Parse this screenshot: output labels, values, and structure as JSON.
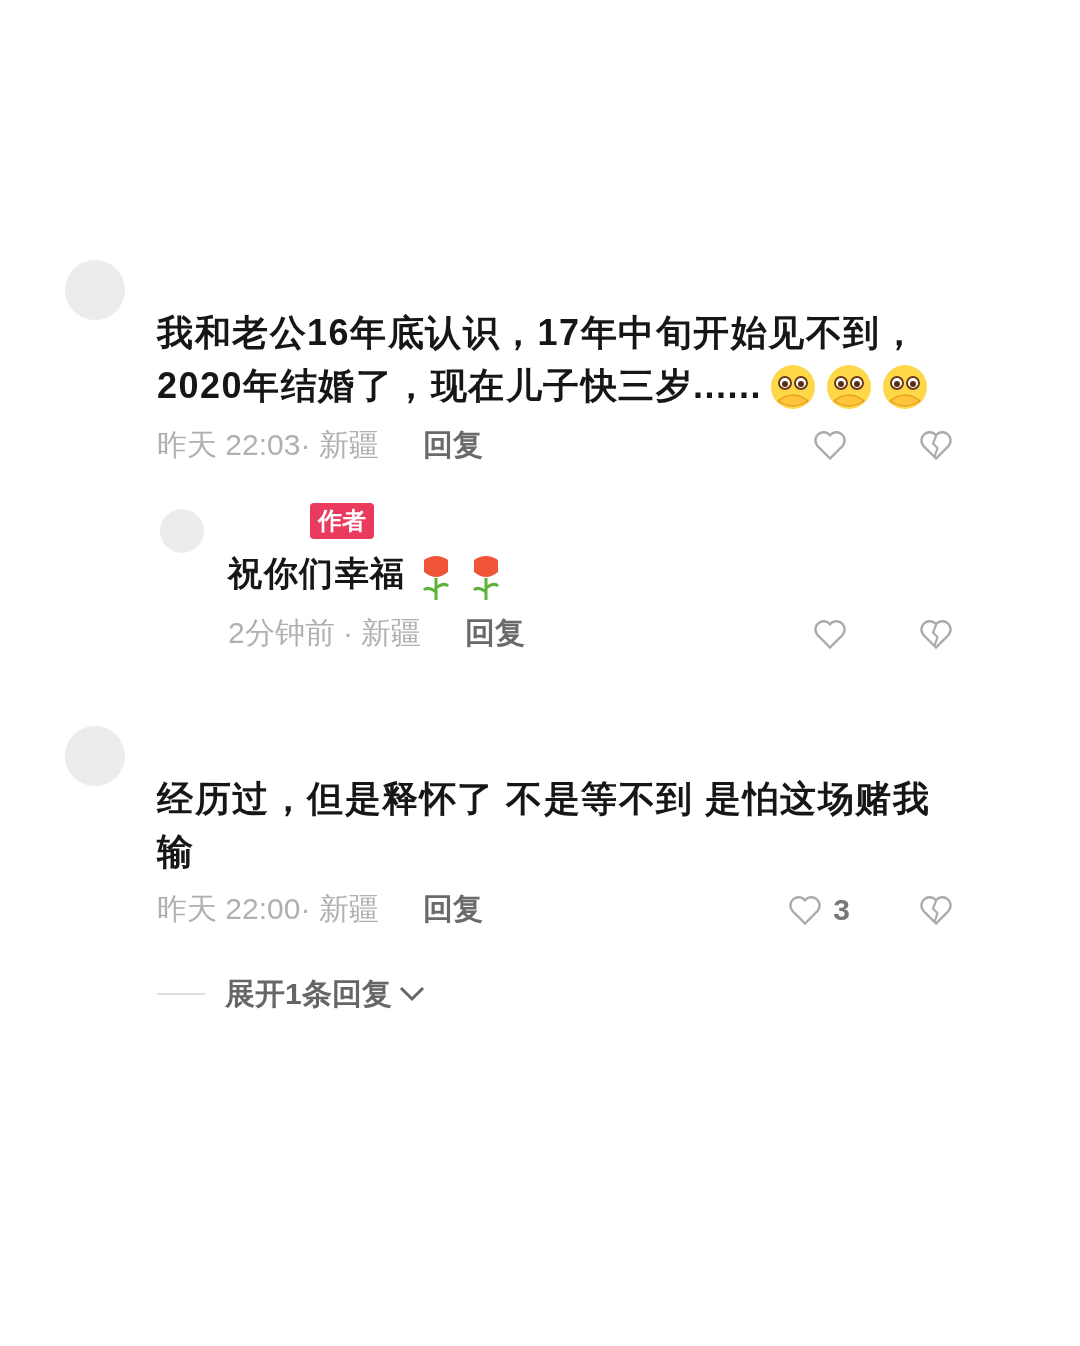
{
  "comments": [
    {
      "text": "我和老公16年底认识，17年中旬开始见不到，2020年结婚了，现在儿子快三岁......",
      "stickers": [
        {
          "kind": "shy-face"
        },
        {
          "kind": "shy-face"
        },
        {
          "kind": "shy-face"
        }
      ],
      "meta": "昨天 22:03· 新疆",
      "reply_label": "回复",
      "replies": [
        {
          "badge": "作者",
          "text": "祝你们幸福",
          "stickers": [
            {
              "kind": "rose"
            },
            {
              "kind": "rose"
            }
          ],
          "meta": "2分钟前 · 新疆",
          "reply_label": "回复"
        }
      ]
    },
    {
      "text": "经历过，但是释怀了  不是等不到 是怕这场赌我输",
      "meta": "昨天 22:00· 新疆",
      "reply_label": "回复",
      "likes": "3",
      "expand": "展开1条回复"
    }
  ]
}
